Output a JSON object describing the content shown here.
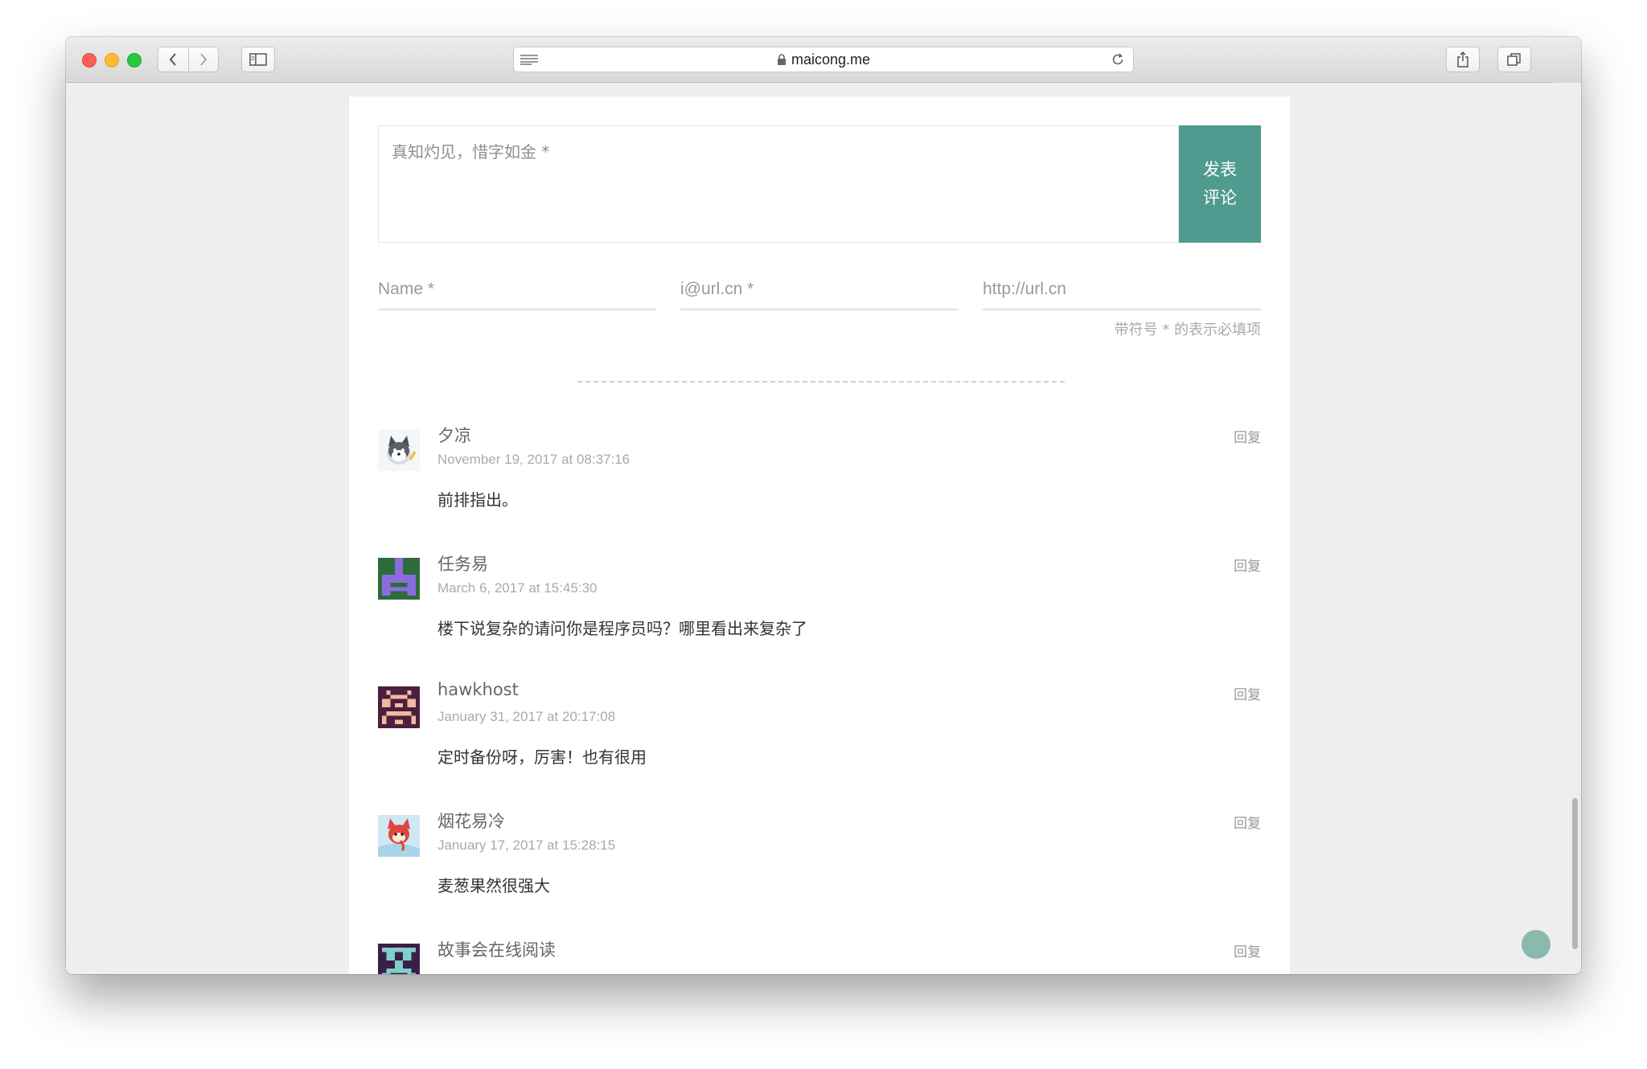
{
  "browser": {
    "url": "maicong.me"
  },
  "form": {
    "comment_placeholder": "真知灼见，惜字如金 *",
    "submit_line1": "发表",
    "submit_line2": "评论",
    "name_placeholder": "Name *",
    "email_placeholder": "i@url.cn *",
    "website_placeholder": "http://url.cn",
    "required_note": "带符号 * 的表示必填项"
  },
  "comments": [
    {
      "author": "夕凉",
      "date": "November 19, 2017 at 08:37:16",
      "text": "前排指出。",
      "reply": "回复"
    },
    {
      "author": "任务易",
      "date": "March 6, 2017 at 15:45:30",
      "text": "楼下说复杂的请问你是程序员吗？哪里看出来复杂了",
      "reply": "回复"
    },
    {
      "author": "hawkhost",
      "date": "January 31, 2017 at 20:17:08",
      "text": "定时备份呀，厉害！也有很用",
      "reply": "回复"
    },
    {
      "author": "烟花易冷",
      "date": "January 17, 2017 at 15:28:15",
      "text": "麦葱果然很强大",
      "reply": "回复"
    },
    {
      "author": "故事会在线阅读",
      "reply": "回复"
    }
  ],
  "colors": {
    "accent": "#4f9b8f",
    "page_background": "#eeeeee",
    "divider": "#b9dcd6"
  }
}
